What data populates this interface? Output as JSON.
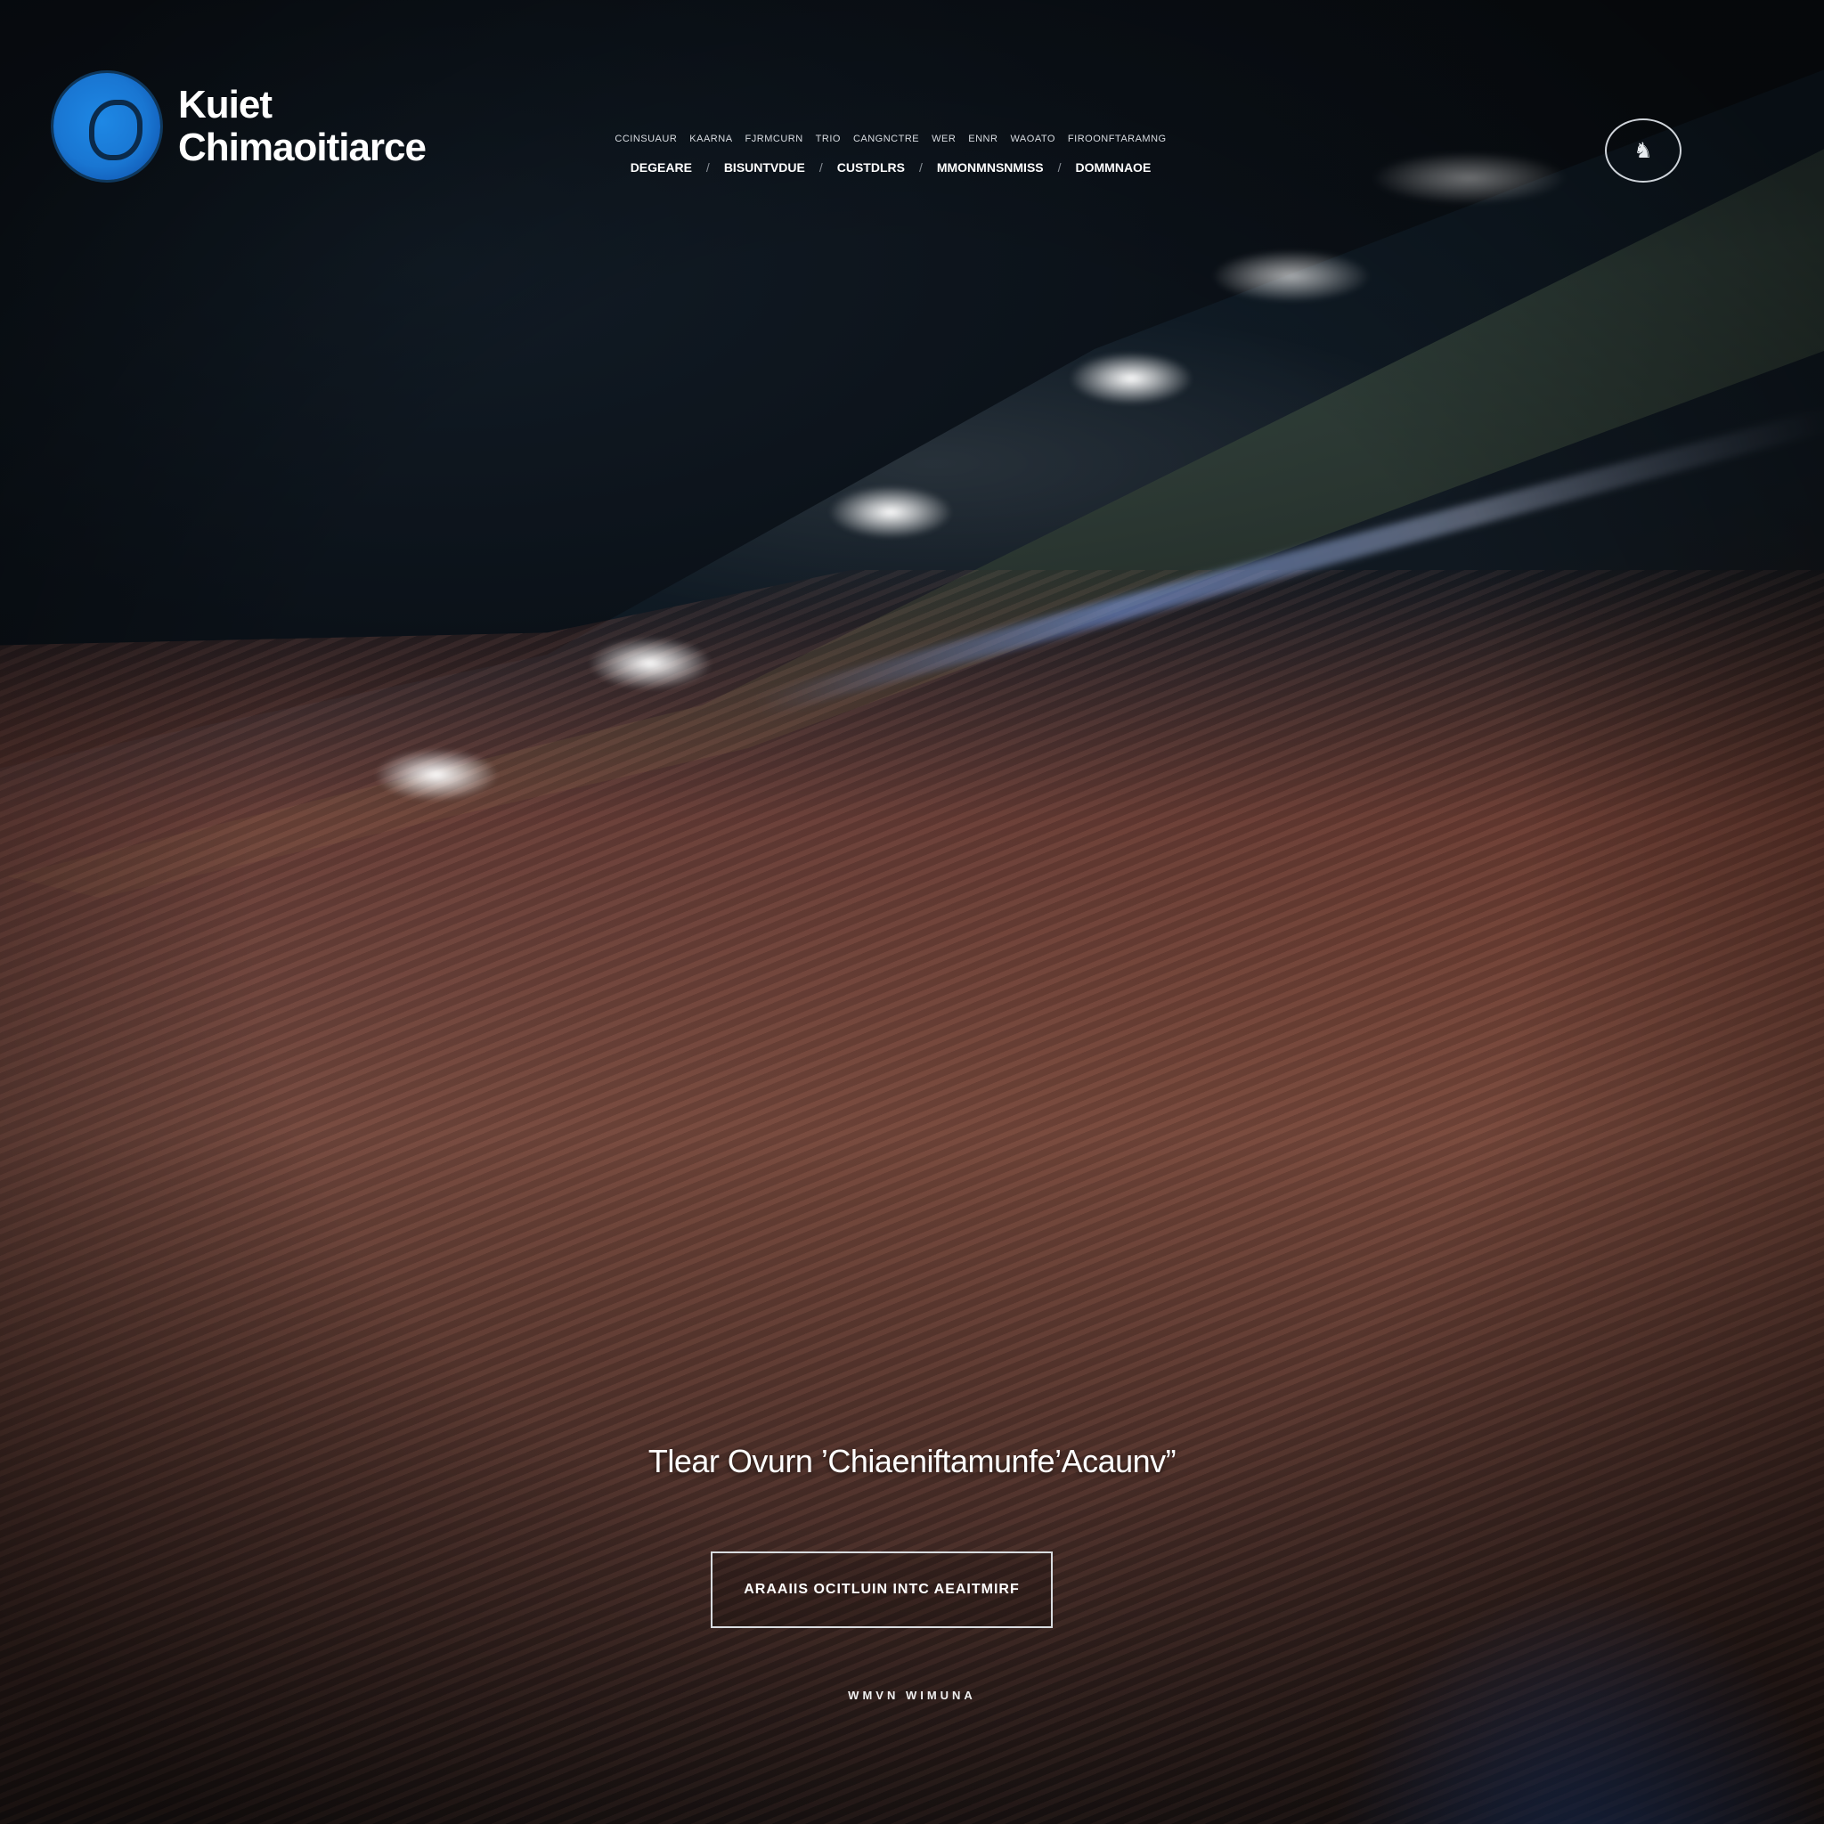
{
  "brand": {
    "name_line1": "Kuiet",
    "name_line2": "Chimaoitiarce",
    "accent_color": "#1e88e5"
  },
  "nav": {
    "top_links": [
      "Ccinsuaur",
      "Kaarna",
      "Fjrmcurn",
      "Trio",
      "Cangnctre",
      "Wer",
      "Ennr",
      "Waoato",
      "Firoonftaramng"
    ],
    "main_links": [
      "Degeare",
      "Bisuntvdue",
      "Custdlrs",
      "Mmonmnsnmiss",
      "Dommnaoe"
    ]
  },
  "header": {
    "badge_icon": "mascot-icon"
  },
  "hero": {
    "tagline": "Tlear Ovurn ’Chiaeniftamunfe’Acaunv”",
    "cta_label": "Araaiis Ocitluin Intc Aeaitmirf",
    "scroll_hint": "Wmvn Wimuna"
  }
}
